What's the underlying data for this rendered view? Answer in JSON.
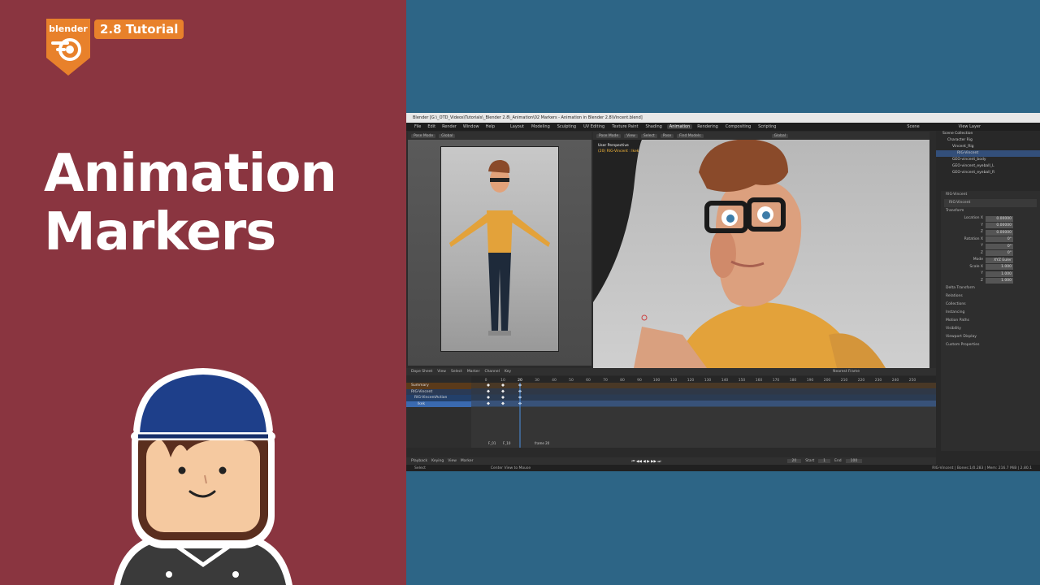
{
  "thumbnail": {
    "brand": "blender",
    "badge": "2.8 Tutorial",
    "title_line1": "Animation",
    "title_line2": "Markers",
    "colors": {
      "left_bg": "#8a3540",
      "right_bg": "#2d6586",
      "accent": "#e8812b"
    }
  },
  "app": {
    "window_title": "Blender [G:\\_OTD_Videos\\Tutorials\\_Blender 2.8\\_Animation\\02 Markers - Animation in Blender 2.8\\Vincent.blend]",
    "menu": [
      "File",
      "Edit",
      "Render",
      "Window",
      "Help"
    ],
    "workspaces": [
      "Layout",
      "Modeling",
      "Sculpting",
      "UV Editing",
      "Texture Paint",
      "Shading",
      "Animation",
      "Rendering",
      "Compositing",
      "Scripting"
    ],
    "active_workspace": "Animation",
    "scene": "Scene",
    "view_layer": "View Layer",
    "left_viewport": {
      "mode": "Pose Mode",
      "orientation": "Global"
    },
    "main_viewport": {
      "mode": "Pose Mode",
      "menus": [
        "View",
        "Select",
        "Pose"
      ],
      "find_models": "Find Models",
      "orientation": "Global",
      "info_line1": "User Perspective",
      "info_line2": "(20) RIG-Vincent : lkek"
    },
    "outliner": {
      "rows": [
        "Scene Collection",
        "Character Rig",
        "Vincent_Rig",
        "RIG-Vincent",
        "GEO-vincent_body",
        "GEO-vincent_eyeball_L",
        "GEO-vincent_eyeball_R"
      ],
      "selected_index": 3
    },
    "properties": {
      "object": "RIG-Vincent",
      "object_field": "RIG-Vincent",
      "transform_label": "Transform",
      "location": [
        [
          "Location X",
          "0.00000"
        ],
        [
          "Y",
          "0.00000"
        ],
        [
          "Z",
          "0.00000"
        ]
      ],
      "rotation": [
        [
          "Rotation X",
          "0°"
        ],
        [
          "Y",
          "0°"
        ],
        [
          "Z",
          "0°"
        ]
      ],
      "mode": [
        "Mode",
        "XYZ Euler"
      ],
      "scale": [
        [
          "Scale X",
          "1.000"
        ],
        [
          "Y",
          "1.000"
        ],
        [
          "Z",
          "1.000"
        ]
      ],
      "sections": [
        "Delta Transform",
        "Relations",
        "Collections",
        "Instancing",
        "Motion Paths",
        "Visibility",
        "Viewport Display",
        "Custom Properties"
      ]
    },
    "dopesheet": {
      "editor": "Dope Sheet",
      "menus": [
        "View",
        "Select",
        "Marker",
        "Channel",
        "Key"
      ],
      "frame_nearest": "Nearest Frame",
      "ruler": [
        "0",
        "10",
        "20",
        "30",
        "40",
        "50",
        "60",
        "70",
        "80",
        "90",
        "100",
        "110",
        "120",
        "130",
        "140",
        "150",
        "160",
        "170",
        "180",
        "190",
        "200",
        "210",
        "220",
        "230",
        "240",
        "250"
      ],
      "current_frame": "20",
      "channels": [
        "Summary",
        "RIG-Vincent",
        "RIG-VincentAction",
        "lkek"
      ],
      "markers": [
        "F_01",
        "F_10",
        "frame 20"
      ]
    },
    "timeline": {
      "menus": [
        "Playback",
        "Keying",
        "View",
        "Marker"
      ],
      "current": "20",
      "start_label": "Start",
      "start": "1",
      "end_label": "End",
      "end": "100"
    },
    "status": {
      "left": "Select",
      "middle": "Center View to Mouse",
      "right": "RIG-Vincent | Bones:1/0.283 | Mem: 216.7 MiB | 2.80.1"
    }
  }
}
